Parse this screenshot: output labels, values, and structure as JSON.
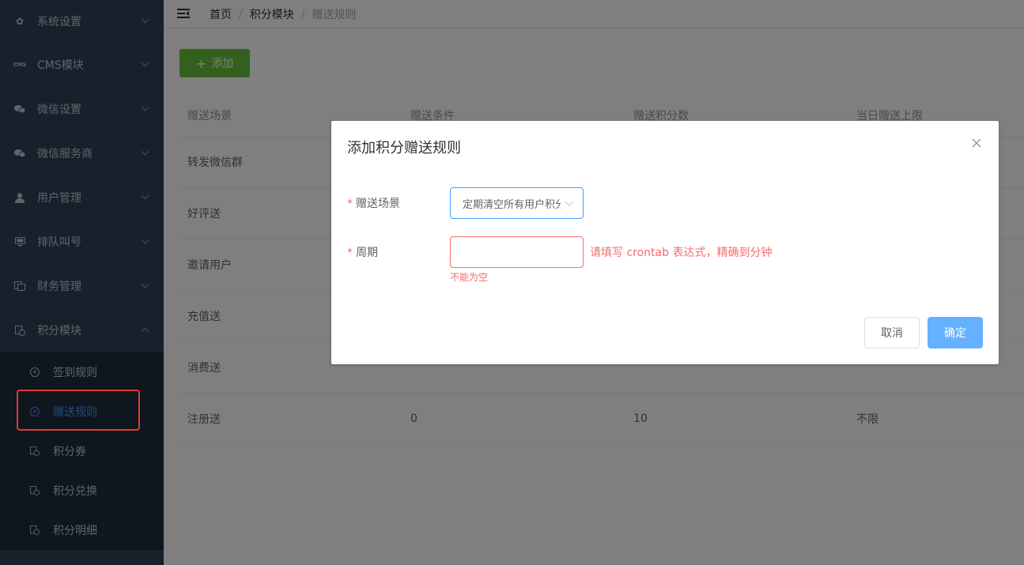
{
  "sidebar": {
    "menu": [
      {
        "label": "系统设置",
        "icon": "gear-icon"
      },
      {
        "label": "CMS模块",
        "icon": "cms-icon"
      },
      {
        "label": "微信设置",
        "icon": "wechat-icon"
      },
      {
        "label": "微信服务商",
        "icon": "wechat-icon"
      },
      {
        "label": "用户管理",
        "icon": "user-icon"
      },
      {
        "label": "排队叫号",
        "icon": "monitor-icon"
      },
      {
        "label": "财务管理",
        "icon": "finance-icon"
      },
      {
        "label": "积分模块",
        "icon": "points-icon"
      }
    ],
    "submenu": [
      {
        "label": "签到规则",
        "icon": "coin-icon"
      },
      {
        "label": "赠送规则",
        "icon": "coin-icon",
        "active": true
      },
      {
        "label": "积分券",
        "icon": "points-icon"
      },
      {
        "label": "积分兑换",
        "icon": "points-icon"
      },
      {
        "label": "积分明细",
        "icon": "points-icon"
      }
    ]
  },
  "breadcrumb": [
    "首页",
    "积分模块",
    "赠送规则"
  ],
  "toolbar": {
    "add_label": "添加"
  },
  "table": {
    "headers": [
      "赠送场景",
      "赠送条件",
      "赠送积分数",
      "当日赠送上限"
    ],
    "rows": [
      [
        "转发微信群",
        "",
        "",
        ""
      ],
      [
        "好评送",
        "",
        "",
        ""
      ],
      [
        "邀请用户",
        "",
        "",
        ""
      ],
      [
        "充值送",
        "",
        "",
        ""
      ],
      [
        "消费送",
        "",
        "",
        ""
      ],
      [
        "注册送",
        "0",
        "10",
        "不限"
      ]
    ]
  },
  "dialog": {
    "title": "添加积分赠送规则",
    "scene_label": "赠送场景",
    "scene_value": "定期清空所有用户积分",
    "period_label": "周期",
    "period_value": "",
    "period_hint": "请填写 crontab 表达式，精确到分钟",
    "period_error": "不能为空",
    "cancel_label": "取消",
    "confirm_label": "确定"
  },
  "colors": {
    "sidebar_bg": "#304156",
    "submenu_bg": "#1f2d3d",
    "active": "#409eff",
    "success": "#67c23a",
    "danger": "#f56c6c"
  }
}
